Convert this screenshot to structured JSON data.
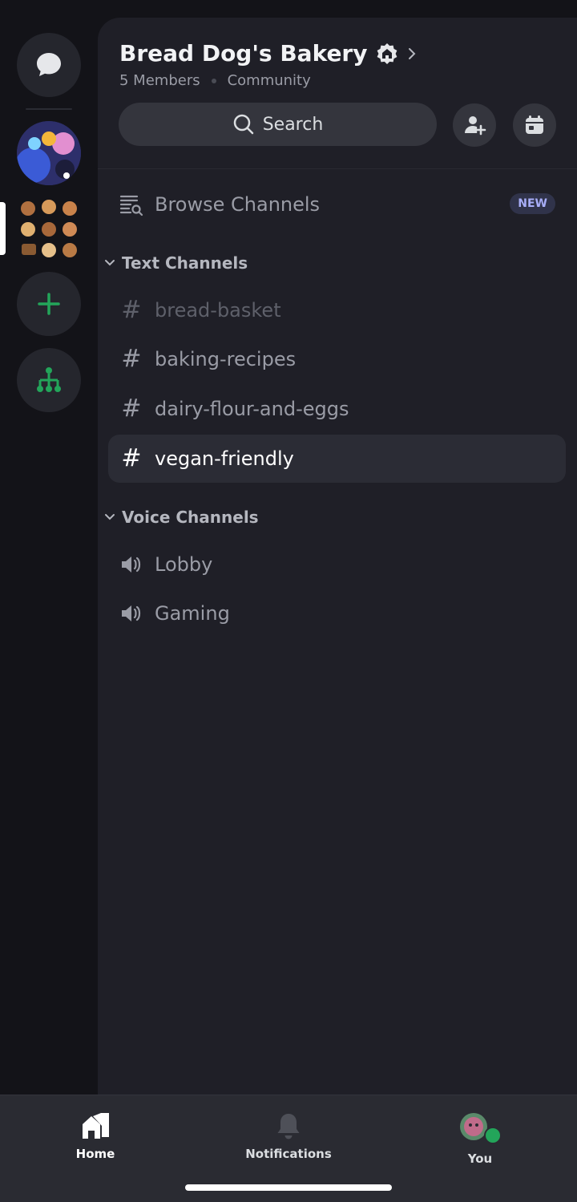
{
  "server": {
    "name": "Bread Dog's Bakery",
    "members": "5 Members",
    "type": "Community"
  },
  "search": {
    "label": "Search"
  },
  "browse": {
    "label": "Browse Channels",
    "badge": "NEW"
  },
  "text_category": {
    "label": "Text Channels",
    "channels": [
      {
        "name": "bread-basket",
        "state": "muted"
      },
      {
        "name": "baking-recipes",
        "state": "normal"
      },
      {
        "name": "dairy-flour-and-eggs",
        "state": "normal"
      },
      {
        "name": "vegan-friendly",
        "state": "active"
      }
    ]
  },
  "voice_category": {
    "label": "Voice Channels",
    "channels": [
      {
        "name": "Lobby"
      },
      {
        "name": "Gaming"
      }
    ]
  },
  "tabs": [
    {
      "label": "Home",
      "icon": "home-icon",
      "active": true
    },
    {
      "label": "Notifications",
      "icon": "bell-icon",
      "active": false
    },
    {
      "label": "You",
      "icon": "avatar-icon",
      "active": false
    }
  ],
  "colors": {
    "accent_green": "#23a55a",
    "badge_text": "#a8aef8",
    "panel_bg": "#1f1f27",
    "rail_bg": "#131318"
  }
}
